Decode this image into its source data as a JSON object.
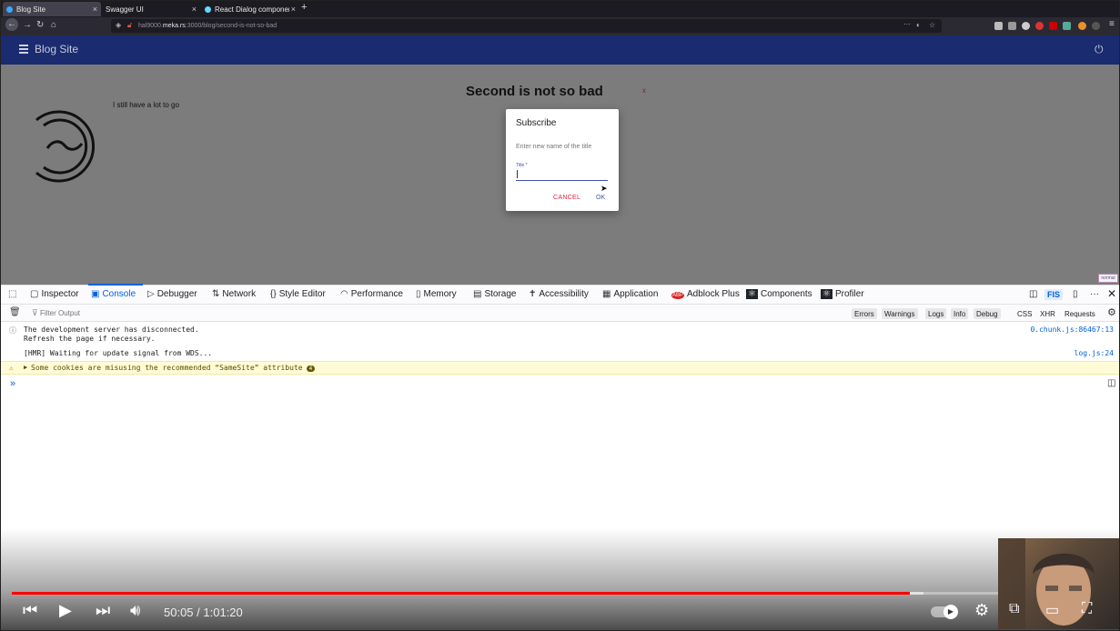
{
  "browser": {
    "tabs": [
      {
        "label": "Blog Site",
        "active": true,
        "fav_color": "#3fa7ff"
      },
      {
        "label": "Swagger UI",
        "active": false,
        "fav_color": "#85ea2d"
      },
      {
        "label": "React Dialog componen",
        "active": false,
        "fav_color": "#61dafb"
      }
    ],
    "url_prefix": "hal9000.",
    "url_domain": "meka.rs",
    "url_path": ":3000/blog/second-is-not-so-bad"
  },
  "page": {
    "site_title": "Blog Site",
    "post_title": "Second is not so bad",
    "post_close": "x",
    "post_text": "I still have a lot to go"
  },
  "dialog": {
    "title": "Subscribe",
    "text": "Enter new name of the title",
    "field_label": "Title *",
    "field_value": "",
    "cancel_label": "CANCEL",
    "ok_label": "OK"
  },
  "zoom_badge": "normal",
  "devtools": {
    "tabs": [
      "Inspector",
      "Console",
      "Debugger",
      "Network",
      "Style Editor",
      "Performance",
      "Memory",
      "Storage",
      "Accessibility",
      "Application",
      "Adblock Plus",
      "Components",
      "Profiler"
    ],
    "active_tab": "Console",
    "fis_label": "FIS",
    "filter_placeholder": "Filter Output",
    "filter_pills": [
      "Errors",
      "Warnings",
      "Logs",
      "Info",
      "Debug"
    ],
    "filter_plain": [
      "CSS",
      "XHR",
      "Requests"
    ],
    "messages": [
      {
        "text": "The development server has disconnected.",
        "text2": "Refresh the page if necessary.",
        "source": "0.chunk.js:86467:13",
        "type": "info"
      },
      {
        "text": "[HMR] Waiting for update signal from WDS...",
        "source": "log.js:24",
        "type": "log"
      },
      {
        "text": "Some cookies are misusing the recommended “SameSite” attribute",
        "count": "4",
        "type": "warning"
      }
    ],
    "prompt": "»"
  },
  "player": {
    "time_current": "50:05",
    "time_total": "1:01:20",
    "progress": 0.818,
    "buffered": 0.83
  }
}
